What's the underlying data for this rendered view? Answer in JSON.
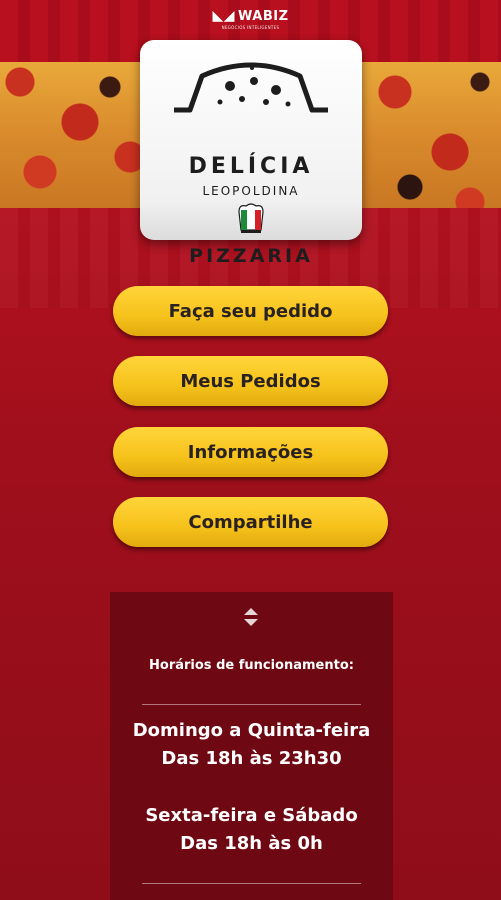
{
  "header": {
    "brand_mark": "WABIZ",
    "brand_tagline": "NEGÓCIOS INTELIGENTES"
  },
  "logo": {
    "name": "DELÍCIA",
    "subtitle": "LEOPOLDINA",
    "category": "PIZZARIA"
  },
  "menu": {
    "items": [
      {
        "label": "Faça seu pedido"
      },
      {
        "label": "Meus Pedidos"
      },
      {
        "label": "Informações"
      },
      {
        "label": "Compartilhe"
      }
    ]
  },
  "info": {
    "title": "Horários de funcionamento:",
    "schedule": [
      {
        "days": "Domingo a Quinta-feira",
        "hours": "Das 18h às 23h30"
      },
      {
        "days": "Sexta-feira e Sábado",
        "hours": "Das 18h às 0h"
      }
    ]
  },
  "colors": {
    "background": "#a00f1c",
    "button": "#f6c21b",
    "panel": "#6e0812"
  }
}
